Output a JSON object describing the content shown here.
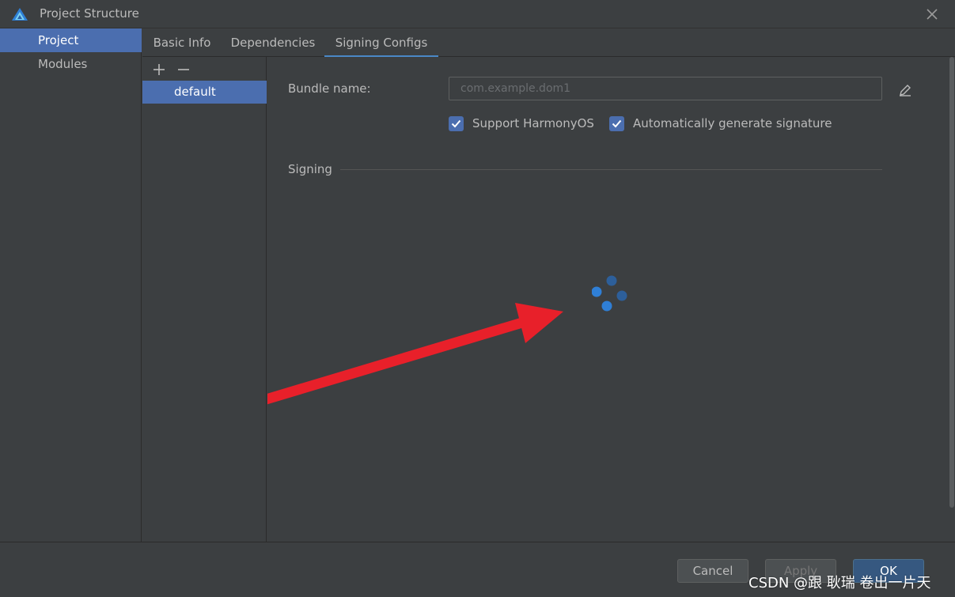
{
  "window": {
    "title": "Project Structure",
    "logo_icon": "harmonyos-logo-icon",
    "close_icon": "close-icon"
  },
  "nav": {
    "items": [
      {
        "label": "Project",
        "selected": true
      },
      {
        "label": "Modules",
        "selected": false
      }
    ]
  },
  "tabs": [
    {
      "label": "Basic Info",
      "active": false
    },
    {
      "label": "Dependencies",
      "active": false
    },
    {
      "label": "Signing Configs",
      "active": true
    }
  ],
  "config_list": {
    "add_icon": "plus-icon",
    "remove_icon": "minus-icon",
    "items": [
      {
        "label": "default",
        "selected": true
      }
    ]
  },
  "form": {
    "bundle_label": "Bundle name:",
    "bundle_placeholder": "com.example.dom1",
    "edit_icon": "pencil-icon",
    "support_harmonyos": {
      "label": "Support HarmonyOS",
      "checked": true
    },
    "auto_signature": {
      "label": "Automatically generate signature",
      "checked": true
    },
    "signing_section": "Signing"
  },
  "loading": {
    "icon": "loading-spinner-icon"
  },
  "annotation": {
    "icon": "red-arrow-icon",
    "color": "#e8202a"
  },
  "footer": {
    "cancel": "Cancel",
    "apply": "Apply",
    "ok": "OK"
  },
  "watermark": "CSDN @跟 耿瑞 卷出一片天",
  "colors": {
    "background": "#3c3f41",
    "selection": "#4b6eaf",
    "accent": "#4a88c7",
    "primary_button": "#365880"
  }
}
